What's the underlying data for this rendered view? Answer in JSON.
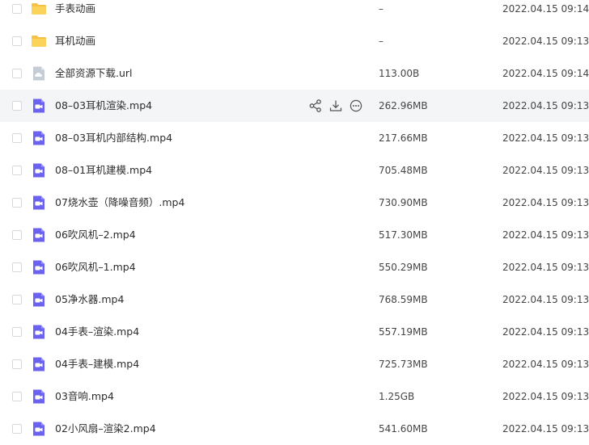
{
  "files": [
    {
      "name": "手表动画",
      "size": "–",
      "date": "2022.04.15 09:14",
      "type": "folder-icon"
    },
    {
      "name": "耳机动画",
      "size": "–",
      "date": "2022.04.15 09:13",
      "type": "folder-icon"
    },
    {
      "name": "全部资源下载.url",
      "size": "113.00B",
      "date": "2022.04.15 09:14",
      "type": "link-file-icon"
    },
    {
      "name": "08–03耳机渲染.mp4",
      "size": "262.96MB",
      "date": "2022.04.15 09:13",
      "type": "video-file-icon",
      "hovered": true
    },
    {
      "name": "08–03耳机内部结构.mp4",
      "size": "217.66MB",
      "date": "2022.04.15 09:13",
      "type": "video-file-icon"
    },
    {
      "name": "08–01耳机建模.mp4",
      "size": "705.48MB",
      "date": "2022.04.15 09:13",
      "type": "video-file-icon"
    },
    {
      "name": "07烧水壶（降噪音频）.mp4",
      "size": "730.90MB",
      "date": "2022.04.15 09:13",
      "type": "video-file-icon"
    },
    {
      "name": "06吹风机–2.mp4",
      "size": "517.30MB",
      "date": "2022.04.15 09:13",
      "type": "video-file-icon"
    },
    {
      "name": "06吹风机–1.mp4",
      "size": "550.29MB",
      "date": "2022.04.15 09:13",
      "type": "video-file-icon"
    },
    {
      "name": "05净水器.mp4",
      "size": "768.59MB",
      "date": "2022.04.15 09:13",
      "type": "video-file-icon"
    },
    {
      "name": "04手表–渲染.mp4",
      "size": "557.19MB",
      "date": "2022.04.15 09:13",
      "type": "video-file-icon"
    },
    {
      "name": "04手表–建模.mp4",
      "size": "725.73MB",
      "date": "2022.04.15 09:13",
      "type": "video-file-icon"
    },
    {
      "name": "03音响.mp4",
      "size": "1.25GB",
      "date": "2022.04.15 09:13",
      "type": "video-file-icon"
    },
    {
      "name": "02小风扇–渲染2.mp4",
      "size": "541.60MB",
      "date": "2022.04.15 09:13",
      "type": "video-file-icon"
    }
  ],
  "row_actions": [
    "share-icon",
    "download-icon",
    "more-icon"
  ],
  "colors": {
    "folder": "#f7c244",
    "video": "#6b63f0",
    "link": "#c4ccd6",
    "hover_bg": "#f4f5f7"
  }
}
